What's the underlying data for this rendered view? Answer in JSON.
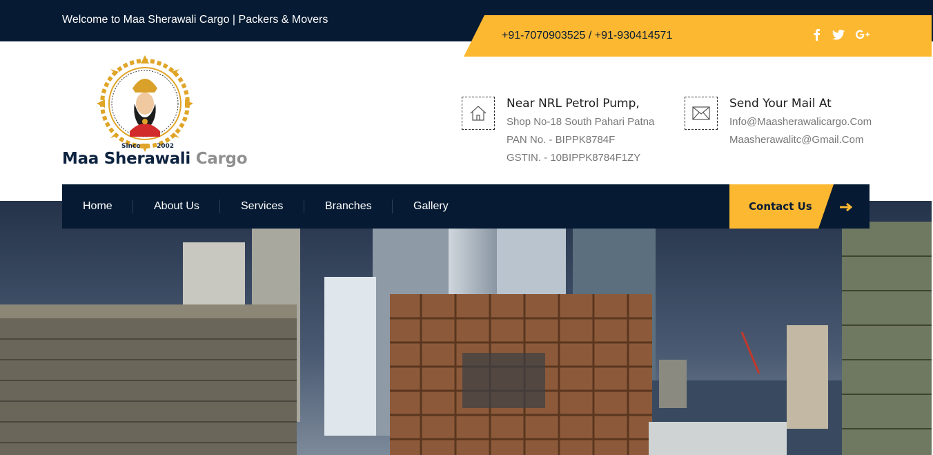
{
  "topbar": {
    "welcome": "Welcome to Maa Sherawali Cargo | Packers & Movers",
    "phone": "+91-7070903525 / +91-930414571",
    "social": [
      "facebook-icon",
      "twitter-icon",
      "google-plus-icon"
    ]
  },
  "logo": {
    "since": "Since",
    "year": "2002",
    "name_main": "Maa Sherawali ",
    "name_accent": "Cargo"
  },
  "address": {
    "title": "Near NRL Petrol Pump,",
    "line1": "Shop No-18 South Pahari Patna",
    "line2": "PAN No. - BIPPK8784F",
    "line3": "GSTIN. - 10BIPPK8784F1ZY"
  },
  "mail": {
    "title": "Send Your Mail At",
    "line1": "Info@Maasherawalicargo.Com",
    "line2": "Maasherawalitc@Gmail.Com"
  },
  "nav": {
    "items": [
      "Home",
      "About Us",
      "Services",
      "Branches",
      "Gallery"
    ],
    "contact": "Contact Us"
  },
  "colors": {
    "navy": "#061b33",
    "accent": "#fdb832"
  }
}
